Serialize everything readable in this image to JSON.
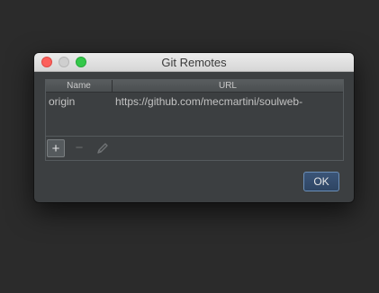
{
  "window": {
    "title": "Git Remotes"
  },
  "table": {
    "columns": [
      "Name",
      "URL"
    ],
    "rows": [
      {
        "name": "origin",
        "url": "https://github.com/mecmartini/soulweb-"
      }
    ]
  },
  "toolbar": {
    "add_symbol": "+",
    "remove_symbol": "−",
    "icons": [
      "add-icon",
      "remove-icon",
      "edit-icon"
    ]
  },
  "buttons": {
    "ok_label": "OK"
  },
  "colors": {
    "background": "#2b2b2b",
    "dialog": "#3c3f41",
    "accent": "#3b5578"
  }
}
